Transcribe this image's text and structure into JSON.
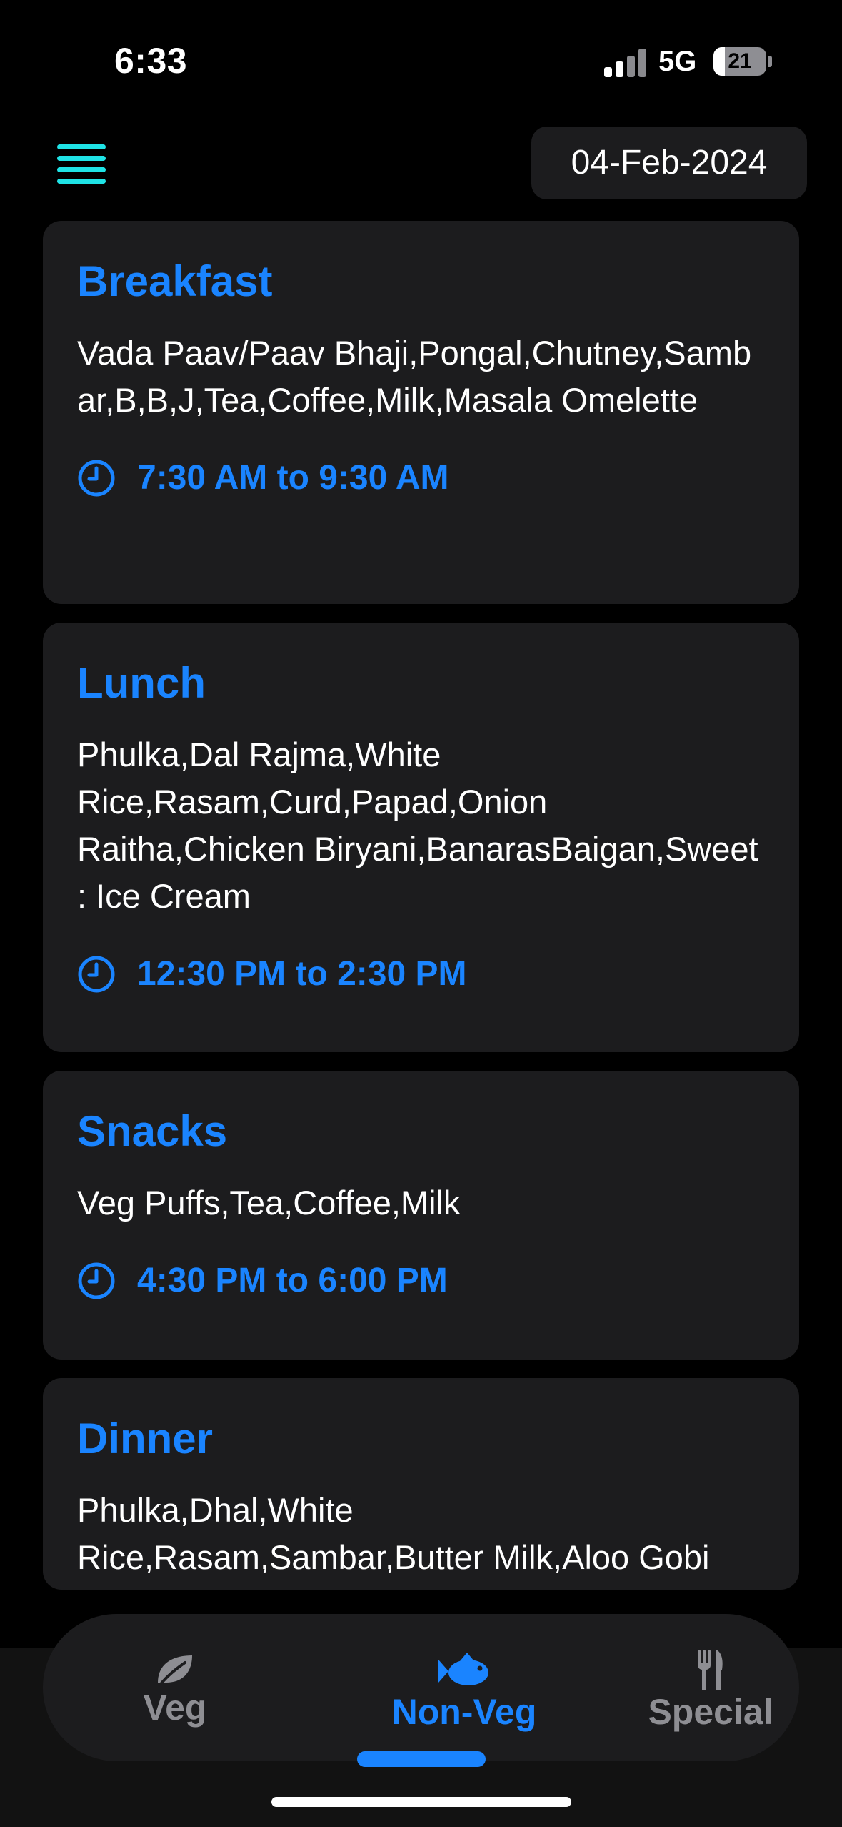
{
  "status_bar": {
    "time": "6:33",
    "network": "5G",
    "battery": "21",
    "battery_level": 0.21
  },
  "header": {
    "menu_icon": "hamburger-menu-icon",
    "date": "04-Feb-2024"
  },
  "meals": [
    {
      "title": "Breakfast",
      "items": "Vada Paav/Paav Bhaji,Pongal,Chutney,Sambar,B,B,J,Tea,Coffee,Milk,Masala Omelette",
      "time": "7:30 AM to 9:30 AM"
    },
    {
      "title": "Lunch",
      "items": "Phulka,Dal Rajma,White Rice,Rasam,Curd,Papad,Onion Raitha,Chicken Biryani,BanarasBaigan,Sweet : Ice Cream",
      "time": "12:30 PM to 2:30 PM"
    },
    {
      "title": "Snacks",
      "items": "Veg Puffs,Tea,Coffee,Milk",
      "time": "4:30 PM to 6:00 PM"
    },
    {
      "title": "Dinner",
      "items": "Phulka,Dhal,White Rice,Rasam,Sambar,Butter Milk,Aloo Gobi"
    }
  ],
  "tabs": [
    {
      "label": "Veg",
      "icon": "leaf-icon",
      "active": false
    },
    {
      "label": "Non-Veg",
      "icon": "fish-icon",
      "active": true
    },
    {
      "label": "Special",
      "icon": "fork-knife-icon",
      "active": false
    }
  ],
  "colors": {
    "accent": "#1a84ff",
    "menu": "#1fe3e6",
    "card": "#1c1c1e",
    "inactive": "#8e8e93"
  }
}
